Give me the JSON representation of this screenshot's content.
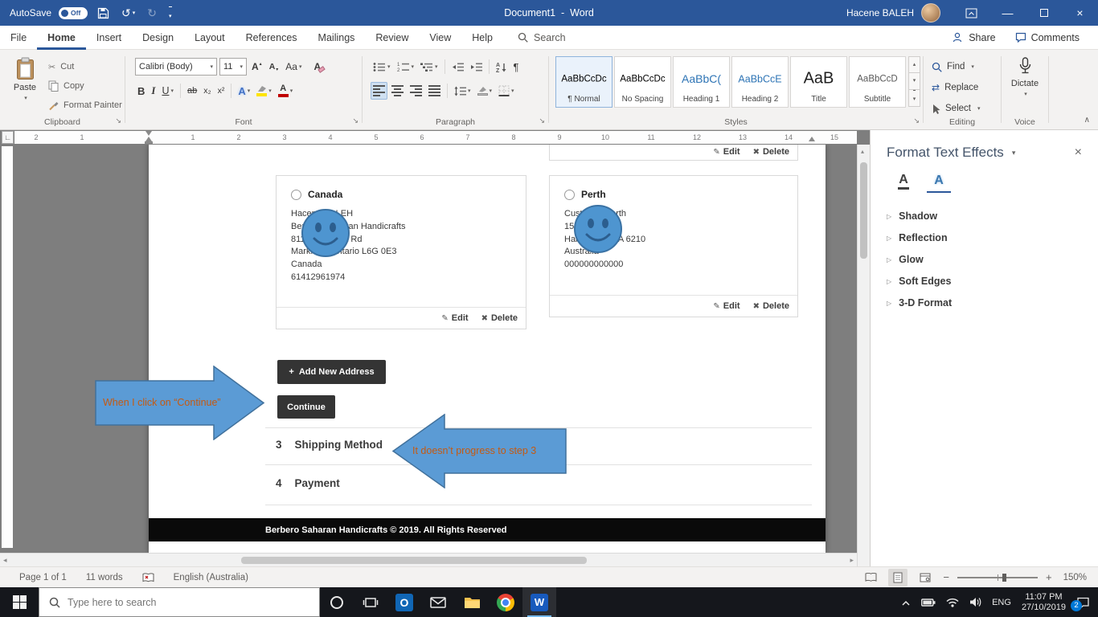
{
  "title_bar": {
    "autosave": "AutoSave",
    "autosave_state": "Off",
    "title": "Document1  -  Word",
    "user": "Hacene BALEH"
  },
  "tabs": {
    "items": [
      "File",
      "Home",
      "Insert",
      "Design",
      "Layout",
      "References",
      "Mailings",
      "Review",
      "View",
      "Help"
    ],
    "active": "Home",
    "search": "Search",
    "share": "Share",
    "comments": "Comments"
  },
  "ribbon": {
    "clipboard": {
      "label": "Clipboard",
      "paste": "Paste",
      "cut": "Cut",
      "copy": "Copy",
      "painter": "Format Painter"
    },
    "font": {
      "label": "Font",
      "name": "Calibri (Body)",
      "size": "11",
      "bold": "B",
      "italic": "I",
      "underline": "U",
      "strike": "ab",
      "sub": "x₂",
      "sup": "x²",
      "effects": "A",
      "case": "Aa",
      "grow": "A",
      "shrink": "A",
      "clear": "A"
    },
    "paragraph": {
      "label": "Paragraph"
    },
    "styles": {
      "label": "Styles",
      "items": [
        {
          "preview": "AaBbCcDc",
          "name": "¶ Normal"
        },
        {
          "preview": "AaBbCcDc",
          "name": "No Spacing"
        },
        {
          "preview": "AaBbC(",
          "name": "Heading 1"
        },
        {
          "preview": "AaBbCcE",
          "name": "Heading 2"
        },
        {
          "preview": "AaB",
          "name": "Title"
        },
        {
          "preview": "AaBbCcD",
          "name": "Subtitle"
        }
      ]
    },
    "editing": {
      "label": "Editing",
      "find": "Find",
      "replace": "Replace",
      "select": "Select"
    },
    "voice": {
      "label": "Voice",
      "dictate": "Dictate"
    }
  },
  "ruler": {
    "left_numbers": [
      "2",
      "1"
    ],
    "numbers": [
      "1",
      "2",
      "3",
      "4",
      "5",
      "6",
      "7",
      "8",
      "9",
      "10",
      "11",
      "12",
      "13",
      "14",
      "15"
    ]
  },
  "doc": {
    "cards": [
      {
        "name": "Canada",
        "lines": [
          "Hacene BALEH",
          "Berbero Saharan Handicrafts",
          "811 Claremont Rd",
          "Markham Ontario L6G 0E3",
          "Canada",
          "61412961974"
        ]
      },
      {
        "name": "Perth",
        "lines": [
          "Customer Perth",
          "15 Forrest St",
          "Halls Head WA 6210",
          "Australia",
          "000000000000"
        ]
      }
    ],
    "edit": "Edit",
    "delete": "Delete",
    "add_address": "Add New Address",
    "continue": "Continue",
    "callout_continue": "When I click on “Continue”",
    "callout_step3": "It doesn’t progress to step 3",
    "step3_num": "3",
    "step3_title": "Shipping Method",
    "step4_num": "4",
    "step4_title": "Payment",
    "footer": "Berbero Saharan Handicrafts © 2019. All Rights Reserved"
  },
  "panel": {
    "title": "Format Text Effects",
    "sections": [
      "Shadow",
      "Reflection",
      "Glow",
      "Soft Edges",
      "3-D Format"
    ]
  },
  "status": {
    "page": "Page 1 of 1",
    "words": "11 words",
    "language": "English (Australia)",
    "zoom": "150%"
  },
  "taskbar": {
    "search": "Type here to search",
    "lang": "ENG",
    "time": "11:07 PM",
    "date": "27/10/2019",
    "badge": "2"
  },
  "icons": {
    "caret_down": "▾",
    "caret_up": "▴",
    "launcher": "↘",
    "edit": "✎",
    "delete": "✖",
    "plus": "+",
    "close": "×",
    "minimize": "—",
    "undo": "↺",
    "redo": "↻",
    "cut": "✂",
    "pilcrow": "¶",
    "expand_tri": "▷",
    "chevron_up": "∧",
    "letter_a": "A",
    "tab_stop": "∟",
    "swap": "⇄"
  },
  "colors": {
    "titlebar": "#2b579a",
    "arrow_fill": "#5b9bd5",
    "arrow_stroke": "#41719c",
    "callout_text": "#c55a11"
  }
}
